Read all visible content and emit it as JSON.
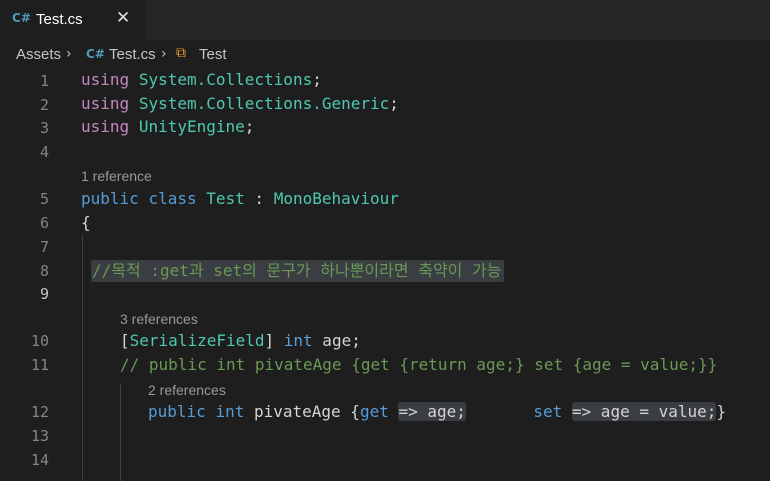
{
  "tab": {
    "file_icon": "csharp-file-icon",
    "icon_glyph": "C#",
    "filename": "Test.cs",
    "close_glyph": "✕"
  },
  "breadcrumb": {
    "folder": "Assets",
    "file": "Test.cs",
    "class_name": "Test",
    "class_icon": "class-icon"
  },
  "editor": {
    "line_numbers": [
      "1",
      "2",
      "3",
      "4",
      "5",
      "6",
      "7",
      "8",
      "9",
      "10",
      "11",
      "12",
      "13",
      "14"
    ],
    "active_line": "9",
    "lines": {
      "l1": {
        "kw": "using",
        "ns": "System.Collections",
        "end": ";"
      },
      "l2": {
        "kw": "using",
        "ns": "System.Collections.Generic",
        "end": ";"
      },
      "l3": {
        "kw": "using",
        "ns": "UnityEngine",
        "end": ";"
      },
      "lens_class": "1 reference",
      "l5": {
        "kw1": "public",
        "kw2": "class",
        "name": "Test",
        "colon": " : ",
        "base": "MonoBehaviour"
      },
      "l6": "{",
      "l8": "//목적 :get과 set의 문구가 하나뿐이라면 축약이 가능",
      "lens_field": "3 references",
      "l10": {
        "open": "[",
        "attr": "SerializeField",
        "close": "] ",
        "kw": "int",
        "rest": " age;"
      },
      "l11": "// public int pivateAge {get {return age;} set {age = value;}}",
      "lens_prop": "2 references",
      "l12": {
        "kw1": "public",
        "kw2": "int",
        "name": " pivateAge {",
        "get": "get",
        "arrow1": "=> age;",
        "set": "set",
        "arrow2": "=> age = value;",
        "end": "}"
      }
    }
  },
  "colors": {
    "background": "#1e1e1e",
    "keyword": "#569cd6",
    "using": "#c586c0",
    "type": "#4ec9b0",
    "comment": "#6a9955"
  }
}
